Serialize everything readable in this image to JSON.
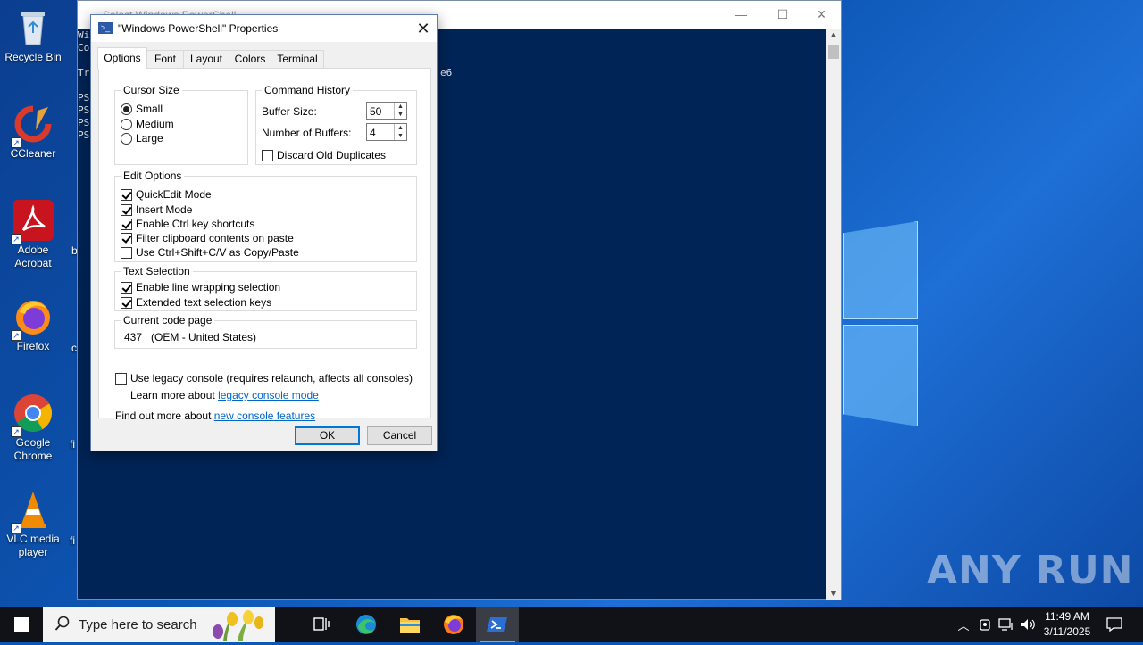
{
  "desktop": {
    "icons": [
      {
        "label": "Recycle Bin"
      },
      {
        "label": "CCleaner"
      },
      {
        "label": "Adobe Acrobat"
      },
      {
        "label": "Firefox"
      },
      {
        "label": "Google Chrome"
      },
      {
        "label": "VLC media player"
      }
    ],
    "edge_texts": [
      "b",
      "c",
      "fi",
      "fi"
    ],
    "watermark": "ANY RUN"
  },
  "ps_window": {
    "title": "Select Windows PowerShell",
    "lines": [
      "Wi",
      "Co",
      "Tr",
      "PS",
      "PS",
      "PS",
      "PS"
    ],
    "line_fragment": "e6"
  },
  "dialog": {
    "title": "\"Windows PowerShell\" Properties",
    "tabs": [
      "Options",
      "Font",
      "Layout",
      "Colors",
      "Terminal"
    ],
    "active_tab": "Options",
    "cursor_size": {
      "label": "Cursor Size",
      "options": [
        {
          "label": "Small",
          "selected": true
        },
        {
          "label": "Medium",
          "selected": false
        },
        {
          "label": "Large",
          "selected": false
        }
      ]
    },
    "command_history": {
      "label": "Command History",
      "buffer_size_label": "Buffer Size:",
      "buffer_size_value": "50",
      "num_buffers_label": "Number of Buffers:",
      "num_buffers_value": "4",
      "discard_label": "Discard Old Duplicates",
      "discard_checked": false
    },
    "edit_options": {
      "label": "Edit Options",
      "items": [
        {
          "label": "QuickEdit Mode",
          "checked": true
        },
        {
          "label": "Insert Mode",
          "checked": true
        },
        {
          "label": "Enable Ctrl key shortcuts",
          "checked": true
        },
        {
          "label": "Filter clipboard contents on paste",
          "checked": true
        },
        {
          "label": "Use Ctrl+Shift+C/V as Copy/Paste",
          "checked": false
        }
      ]
    },
    "text_selection": {
      "label": "Text Selection",
      "items": [
        {
          "label": "Enable line wrapping selection",
          "checked": true
        },
        {
          "label": "Extended text selection keys",
          "checked": true
        }
      ]
    },
    "code_page": {
      "label": "Current code page",
      "value": "437   (OEM - United States)"
    },
    "legacy": {
      "label": "Use legacy console (requires relaunch, affects all consoles)",
      "checked": false,
      "learn_prefix": "Learn more about",
      "learn_link": "legacy console mode"
    },
    "features": {
      "prefix": "Find out more about",
      "link": "new console features"
    },
    "ok_label": "OK",
    "cancel_label": "Cancel"
  },
  "taskbar": {
    "search_placeholder": "Type here to search",
    "time": "11:49 AM",
    "date": "3/11/2025"
  }
}
